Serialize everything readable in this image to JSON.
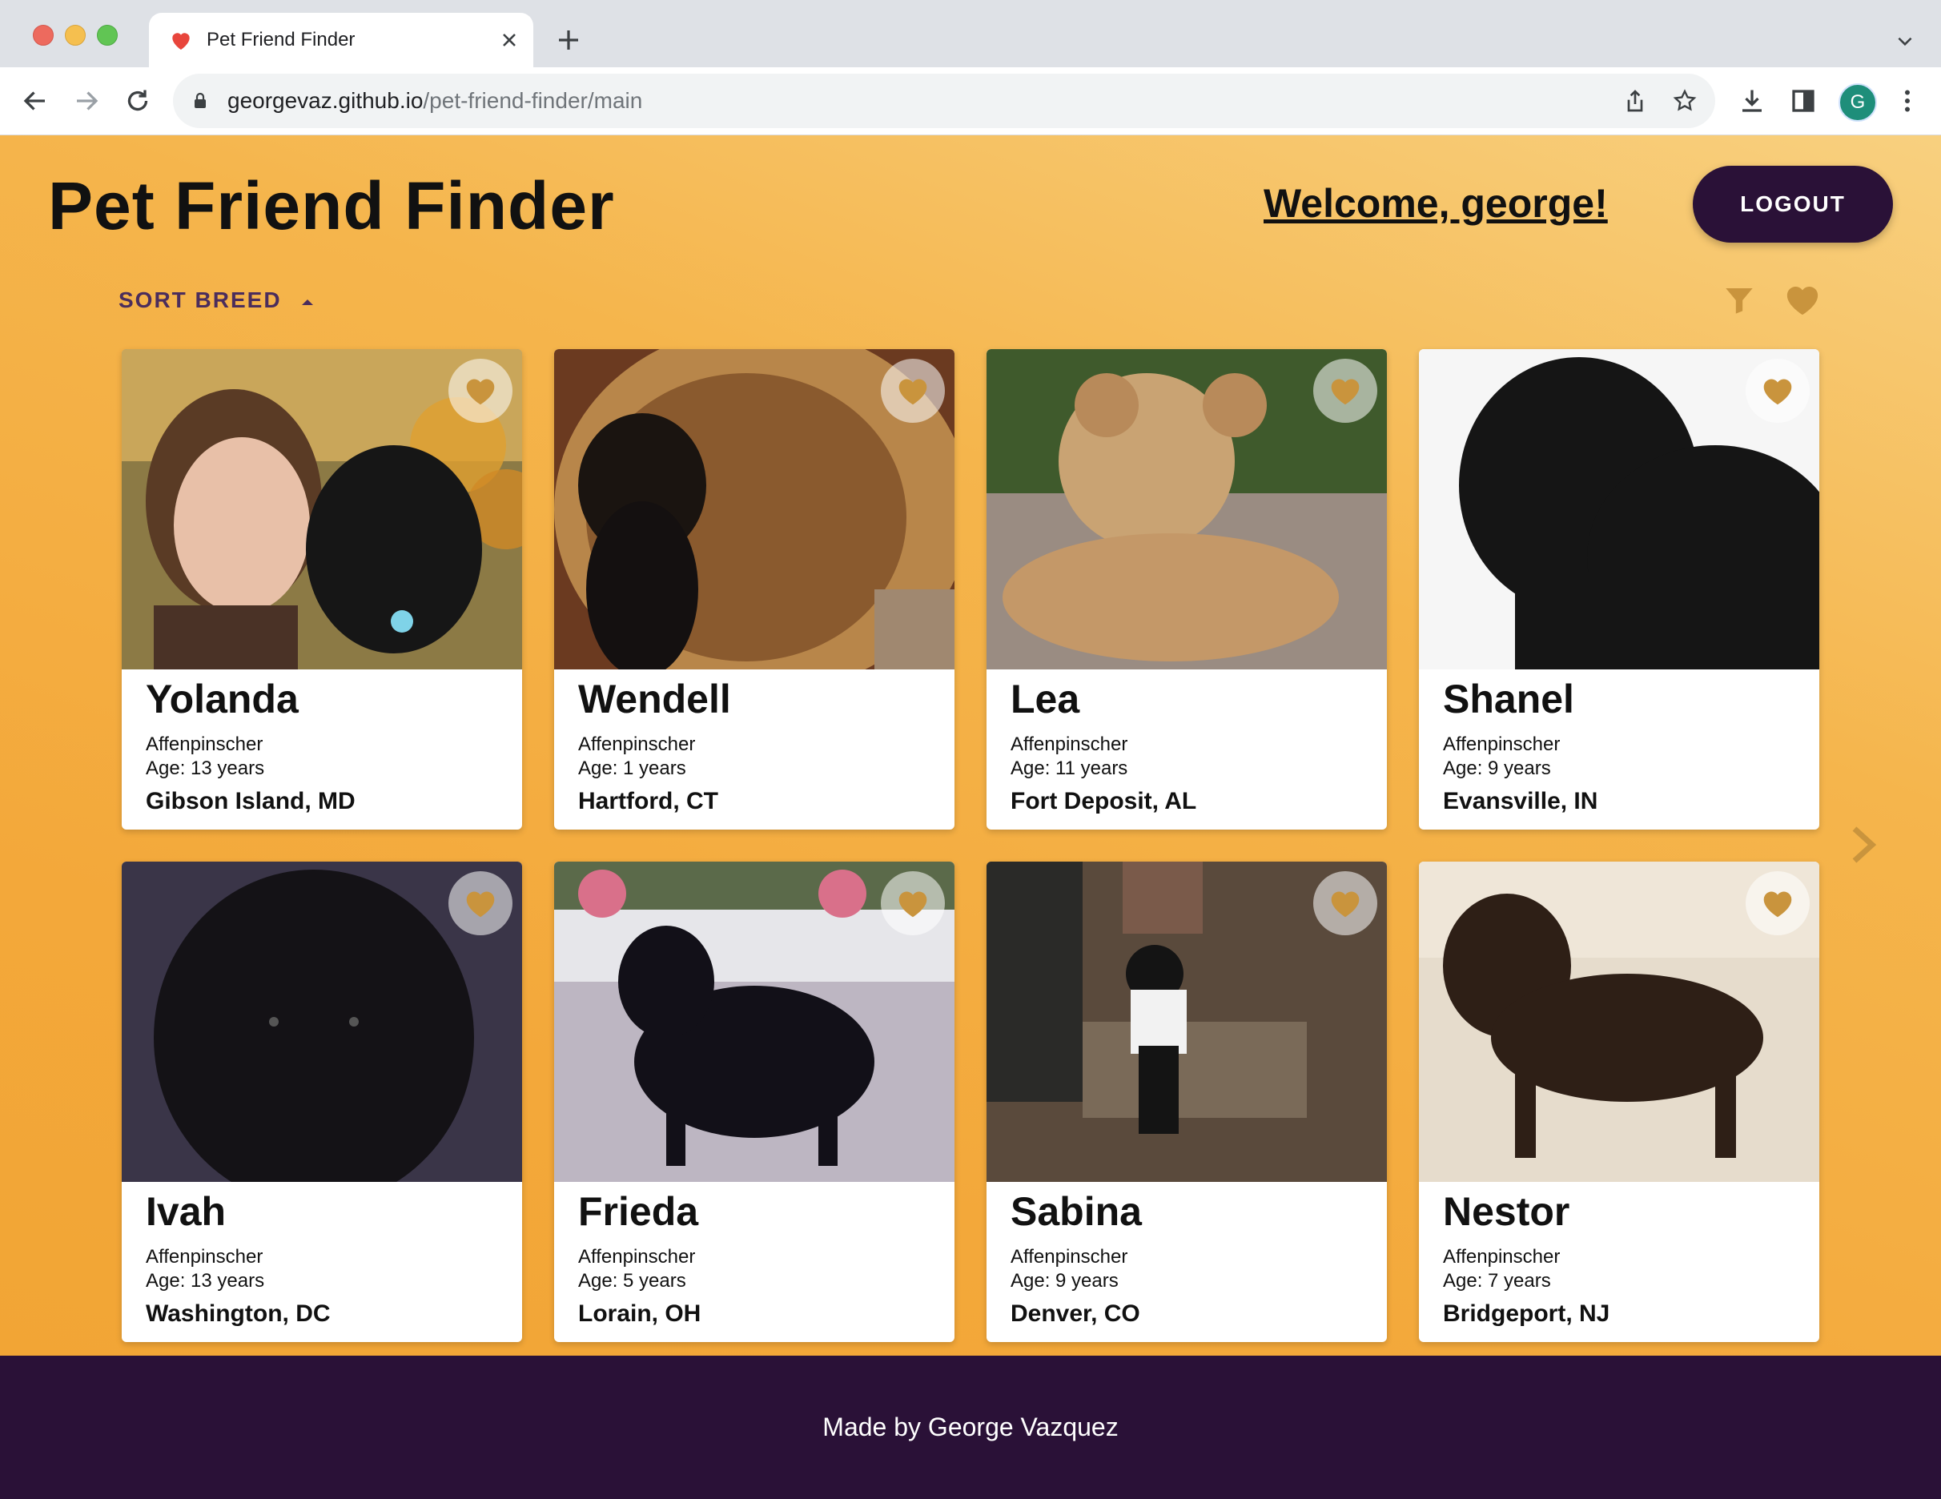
{
  "browser": {
    "tab_title": "Pet Friend Finder",
    "url_host": "georgevaz.github.io",
    "url_path": "/pet-friend-finder/main",
    "profile_initial": "G"
  },
  "header": {
    "title": "Pet Friend Finder",
    "welcome": "Welcome, george!",
    "logout_label": "LOGOUT"
  },
  "controls": {
    "sort_label": "SORT BREED"
  },
  "colors": {
    "accent_purple": "#2a1137",
    "heart_gold": "#c9943d",
    "background_orange": "#f3a83a"
  },
  "pets": [
    {
      "name": "Yolanda",
      "breed": "Affenpinscher",
      "age": "Age: 13 years",
      "location": "Gibson Island, MD"
    },
    {
      "name": "Wendell",
      "breed": "Affenpinscher",
      "age": "Age: 1 years",
      "location": "Hartford, CT"
    },
    {
      "name": "Lea",
      "breed": "Affenpinscher",
      "age": "Age: 11 years",
      "location": "Fort Deposit, AL"
    },
    {
      "name": "Shanel",
      "breed": "Affenpinscher",
      "age": "Age: 9 years",
      "location": "Evansville, IN"
    },
    {
      "name": "Ivah",
      "breed": "Affenpinscher",
      "age": "Age: 13 years",
      "location": "Washington, DC"
    },
    {
      "name": "Frieda",
      "breed": "Affenpinscher",
      "age": "Age: 5 years",
      "location": "Lorain, OH"
    },
    {
      "name": "Sabina",
      "breed": "Affenpinscher",
      "age": "Age: 9 years",
      "location": "Denver, CO"
    },
    {
      "name": "Nestor",
      "breed": "Affenpinscher",
      "age": "Age: 7 years",
      "location": "Bridgeport, NJ"
    }
  ],
  "footer": {
    "text": "Made by George Vazquez"
  }
}
